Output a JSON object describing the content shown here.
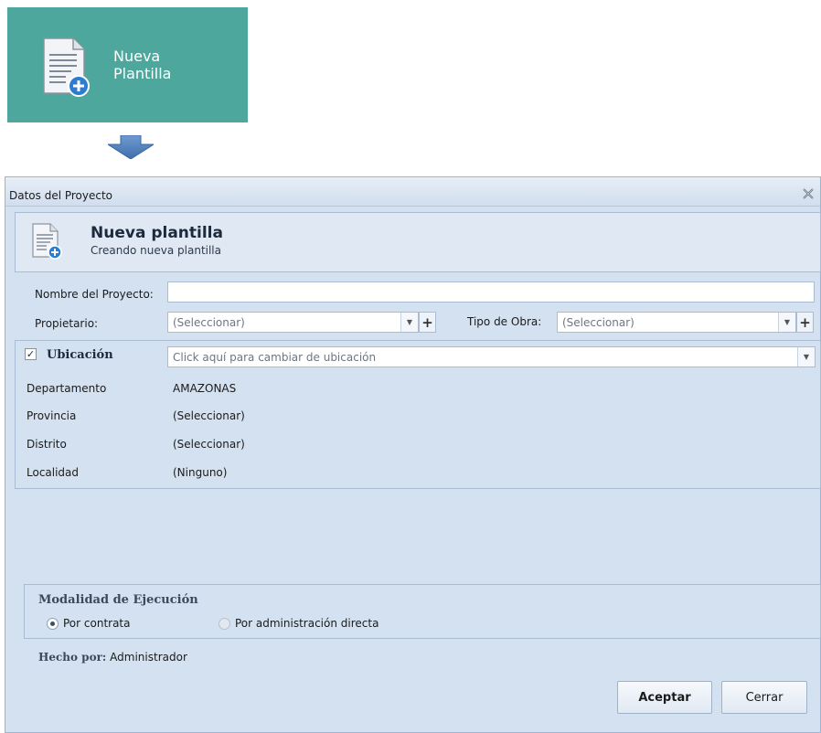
{
  "ribbon": {
    "tile_label_line1": "Nueva",
    "tile_label_line2": "Plantilla",
    "tile_icon": "document-add-icon",
    "tile_color": "#4ea79c"
  },
  "dialog": {
    "title": "Datos del Proyecto",
    "header_title": "Nueva plantilla",
    "header_subtitle": "Creando nueva plantilla"
  },
  "form": {
    "nombre_label": "Nombre del Proyecto:",
    "nombre_value": "",
    "propietario_label": "Propietario:",
    "propietario_placeholder": "(Seleccionar)",
    "tipo_obra_label": "Tipo de Obra:",
    "tipo_obra_placeholder": "(Seleccionar)",
    "plus_symbol": "+",
    "dropdown_symbol": "▼"
  },
  "ubicacion": {
    "checkbox_checked": true,
    "check_mark": "✓",
    "label": "Ubicación",
    "combo_placeholder": "Click aquí para cambiar de ubicación",
    "rows": [
      {
        "label": "Departamento",
        "value": "AMAZONAS"
      },
      {
        "label": "Provincia",
        "value": "(Seleccionar)"
      },
      {
        "label": "Distrito",
        "value": "(Seleccionar)"
      },
      {
        "label": "Localidad",
        "value": "(Ninguno)"
      }
    ]
  },
  "modalidad": {
    "title": "Modalidad de Ejecución",
    "options": [
      {
        "label": "Por contrata",
        "selected": true
      },
      {
        "label": "Por administración directa",
        "selected": false
      }
    ]
  },
  "footer": {
    "hecho_por_label": "Hecho por:",
    "hecho_por_value": "Administrador",
    "accept_label": "Aceptar",
    "close_label": "Cerrar"
  }
}
